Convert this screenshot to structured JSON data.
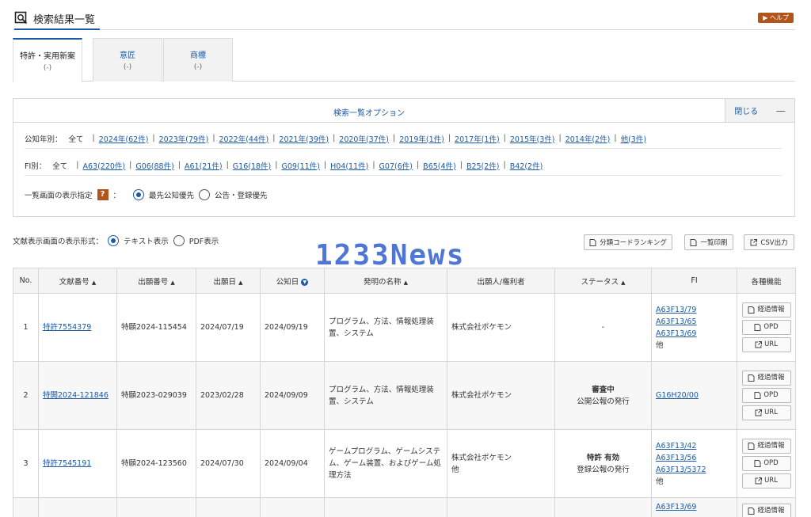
{
  "page": {
    "title": "検索結果一覧",
    "help_label": "▶ ヘルプ"
  },
  "tabs": [
    {
      "label": "特許・実用新案",
      "count": "(-)"
    },
    {
      "label": "意匠",
      "count": "(-)"
    },
    {
      "label": "商標",
      "count": "(-)"
    }
  ],
  "options": {
    "title": "検索一覧オプション",
    "close_label": "閉じる",
    "close_symbol": "—",
    "year": {
      "label": "公知年別：",
      "all": "全て",
      "items": [
        "2024年(62件)",
        "2023年(79件)",
        "2022年(44件)",
        "2021年(39件)",
        "2020年(37件)",
        "2019年(1件)",
        "2017年(1件)",
        "2015年(3件)",
        "2014年(2件)",
        "他(3件)"
      ]
    },
    "fi": {
      "label": "FI別：",
      "all": "全て",
      "items": [
        "A63(220件)",
        "G06(88件)",
        "A61(21件)",
        "G16(18件)",
        "G09(11件)",
        "H04(11件)",
        "G07(6件)",
        "B65(4件)",
        "B25(2件)",
        "B42(2件)"
      ]
    },
    "display": {
      "label": "一覧画面の表示指定",
      "help": "?",
      "colon": "：",
      "opt1": "最先公知優先",
      "opt2": "公告・登録優先"
    }
  },
  "toolbar": {
    "format_label": "文献表示画面の表示形式：",
    "format_text": "テキスト表示",
    "format_pdf": "PDF表示",
    "btn_ranking": "分類コードランキング",
    "btn_print": "一覧印刷",
    "btn_csv": "CSV出力"
  },
  "watermark": "1233News",
  "table": {
    "headers": [
      "No.",
      "文献番号",
      "出願番号",
      "出願日",
      "公知日",
      "発明の名称",
      "出願人/権利者",
      "ステータス",
      "FI",
      "各種機能"
    ],
    "sort_marker": "▲",
    "active_sort_marker": "▼",
    "func_labels": {
      "history": "経過情報",
      "opd": "OPD",
      "url": "URL"
    },
    "rows": [
      {
        "no": "1",
        "doc": "特許7554379",
        "app": "特願2024-115454",
        "app_date": "2024/07/19",
        "pub_date": "2024/09/19",
        "title": "プログラム、方法、情報処理装置、システム",
        "applicant": "株式会社ポケモン",
        "applicant2": "",
        "status_main": "",
        "status_sub": "-",
        "fi": [
          "A63F13/79",
          "A63F13/65",
          "A63F13/69"
        ],
        "fi_more": "他"
      },
      {
        "no": "2",
        "doc": "特開2024-121846",
        "app": "特願2023-029039",
        "app_date": "2023/02/28",
        "pub_date": "2024/09/09",
        "title": "プログラム、方法、情報処理装置、システム",
        "applicant": "株式会社ポケモン",
        "applicant2": "",
        "status_main": "審査中",
        "status_sub": "公開公報の発行",
        "fi": [
          "G16H20/00"
        ],
        "fi_more": ""
      },
      {
        "no": "3",
        "doc": "特許7545191",
        "app": "特願2024-123560",
        "app_date": "2024/07/30",
        "pub_date": "2024/09/04",
        "title": "ゲームプログラム、ゲームシステム、ゲーム装置、およびゲーム処理方法",
        "applicant": "株式会社ポケモン",
        "applicant2": "他",
        "status_main": "特許 有効",
        "status_sub": "登録公報の発行",
        "fi": [
          "A63F13/42",
          "A63F13/56",
          "A63F13/5372"
        ],
        "fi_more": "他"
      },
      {
        "no": "",
        "doc": "",
        "app": "",
        "app_date": "",
        "pub_date": "",
        "title": "",
        "applicant": "",
        "applicant2": "",
        "status_main": "",
        "status_sub": "",
        "fi": [
          "A63F13/69"
        ],
        "fi_more": ""
      }
    ]
  }
}
